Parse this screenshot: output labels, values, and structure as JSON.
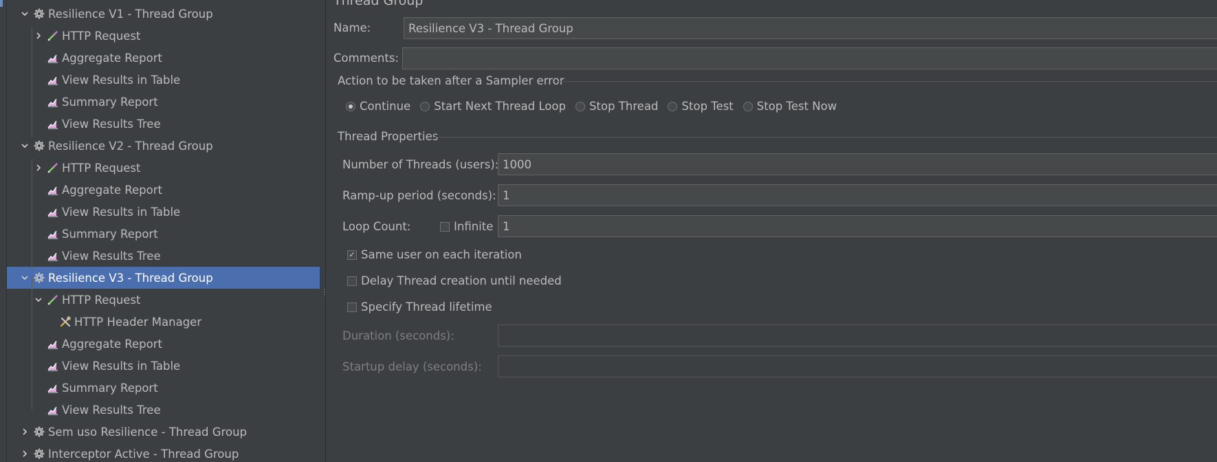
{
  "tree": {
    "items": [
      {
        "label": "Resilience V1 - Thread Group",
        "icon": "gear-icon",
        "arrow": "expanded",
        "level": 0
      },
      {
        "label": "HTTP Request",
        "icon": "pipette-icon",
        "arrow": "collapsed",
        "level": 1
      },
      {
        "label": "Aggregate Report",
        "icon": "chart-icon",
        "arrow": "none",
        "level": 1
      },
      {
        "label": "View Results in Table",
        "icon": "chart-icon",
        "arrow": "none",
        "level": 1
      },
      {
        "label": "Summary Report",
        "icon": "chart-icon",
        "arrow": "none",
        "level": 1
      },
      {
        "label": "View Results Tree",
        "icon": "chart-icon",
        "arrow": "none",
        "level": 1
      },
      {
        "label": "Resilience V2 - Thread Group",
        "icon": "gear-icon",
        "arrow": "expanded",
        "level": 0
      },
      {
        "label": "HTTP Request",
        "icon": "pipette-icon",
        "arrow": "collapsed",
        "level": 1
      },
      {
        "label": "Aggregate Report",
        "icon": "chart-icon",
        "arrow": "none",
        "level": 1
      },
      {
        "label": "View Results in Table",
        "icon": "chart-icon",
        "arrow": "none",
        "level": 1
      },
      {
        "label": "Summary Report",
        "icon": "chart-icon",
        "arrow": "none",
        "level": 1
      },
      {
        "label": "View Results Tree",
        "icon": "chart-icon",
        "arrow": "none",
        "level": 1
      },
      {
        "label": "Resilience V3 - Thread Group",
        "icon": "gear-icon",
        "arrow": "expanded",
        "level": 0,
        "selected": true
      },
      {
        "label": "HTTP Request",
        "icon": "pipette-icon",
        "arrow": "expanded",
        "level": 1
      },
      {
        "label": "HTTP Header Manager",
        "icon": "tools-icon",
        "arrow": "none",
        "level": 2
      },
      {
        "label": "Aggregate Report",
        "icon": "chart-icon",
        "arrow": "none",
        "level": 1
      },
      {
        "label": "View Results in Table",
        "icon": "chart-icon",
        "arrow": "none",
        "level": 1
      },
      {
        "label": "Summary Report",
        "icon": "chart-icon",
        "arrow": "none",
        "level": 1
      },
      {
        "label": "View Results Tree",
        "icon": "chart-icon",
        "arrow": "none",
        "level": 1
      },
      {
        "label": "Sem uso Resilience  - Thread Group",
        "icon": "gear-icon",
        "arrow": "collapsed",
        "level": 0
      },
      {
        "label": "Interceptor Active - Thread Group",
        "icon": "gear-icon",
        "arrow": "collapsed",
        "level": 0
      }
    ]
  },
  "panel": {
    "title": "Thread Group",
    "name_label": "Name:",
    "name_value": "Resilience V3 - Thread Group",
    "comments_label": "Comments:",
    "comments_value": "",
    "sampler_error": {
      "heading": "Action to be taken after a Sampler error",
      "options": [
        {
          "label": "Continue",
          "selected": true
        },
        {
          "label": "Start Next Thread Loop",
          "selected": false
        },
        {
          "label": "Stop Thread",
          "selected": false
        },
        {
          "label": "Stop Test",
          "selected": false
        },
        {
          "label": "Stop Test Now",
          "selected": false
        }
      ]
    },
    "thread_properties": {
      "heading": "Thread Properties",
      "threads_label": "Number of Threads (users):",
      "threads_value": "1000",
      "rampup_label": "Ramp-up period (seconds):",
      "rampup_value": "1",
      "loop_label": "Loop Count:",
      "infinite_label": "Infinite",
      "infinite_checked": false,
      "loop_value": "1",
      "same_user_label": "Same user on each iteration",
      "same_user_checked": true,
      "delay_label": "Delay Thread creation until needed",
      "delay_checked": false,
      "lifetime_label": "Specify Thread lifetime",
      "lifetime_checked": false,
      "duration_label": "Duration (seconds):",
      "duration_value": "",
      "startup_label": "Startup delay (seconds):",
      "startup_value": ""
    }
  },
  "colors": {
    "background": "#3c3f41",
    "selection": "#4b6eaf",
    "text": "#bbbbbb",
    "field_bg": "#45494a"
  }
}
